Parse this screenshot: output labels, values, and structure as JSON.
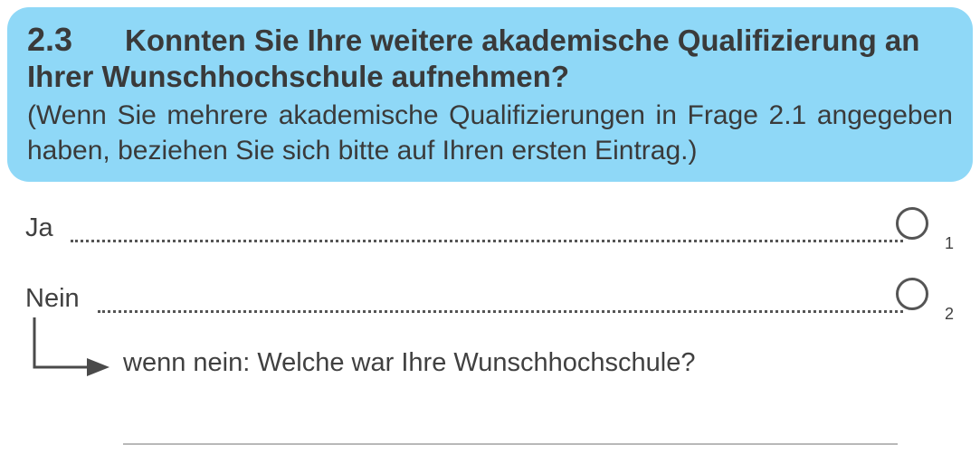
{
  "question": {
    "number": "2.3",
    "title": "Konnten Sie Ihre weitere akademische Qualifizierung an Ihrer Wunschhochschule aufnehmen?",
    "hint": "(Wenn Sie mehrere akademische Qualifizierungen in Frage 2.1 angegeben haben, beziehen Sie sich bitte auf Ihren ersten Eintrag.)"
  },
  "options": [
    {
      "label": "Ja",
      "code": "1"
    },
    {
      "label": "Nein",
      "code": "2"
    }
  ],
  "followup": {
    "label": "wenn nein: Welche war Ihre Wunschhochschule?",
    "answer": ""
  },
  "colors": {
    "question_background": "#8fd8f7",
    "text": "#404040"
  }
}
